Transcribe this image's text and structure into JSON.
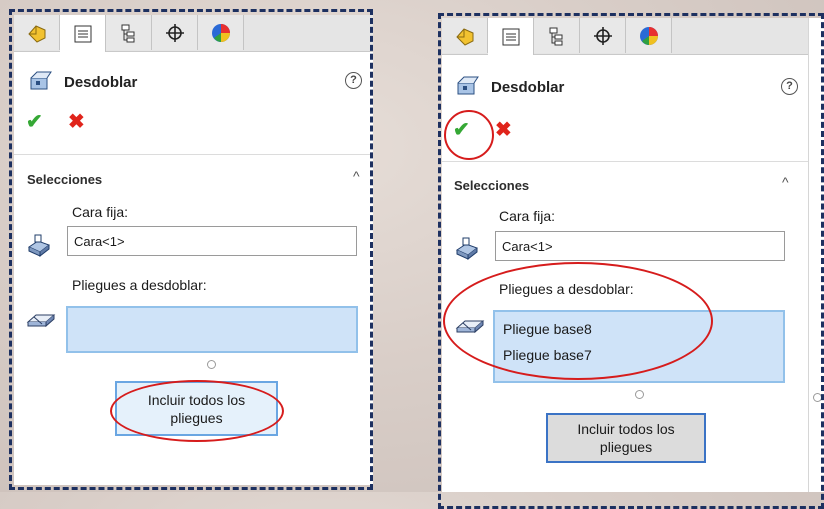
{
  "colors": {
    "accent_blue": "#92c1ea",
    "list_fill": "#cfe3f8",
    "ok_green": "#35a835",
    "cancel_red": "#e0241b",
    "annotation_red": "#d61c1c",
    "dash_border": "#1d3060"
  },
  "tabs": [
    {
      "icon": "feature-manager-icon"
    },
    {
      "icon": "property-manager-icon"
    },
    {
      "icon": "configuration-manager-icon"
    },
    {
      "icon": "dimxpert-icon"
    },
    {
      "icon": "display-manager-icon"
    }
  ],
  "panel_left": {
    "title": "Desdoblar",
    "help": "?",
    "ok": "✔",
    "cancel": "✖",
    "section": "Selecciones",
    "caret": "^",
    "fixed_face_label": "Cara fija:",
    "fixed_face_value": "Cara<1>",
    "bends_label": "Pliegues a desdoblar:",
    "bends": [],
    "include_all_button": "Incluir todos los pliegues"
  },
  "panel_right": {
    "title": "Desdoblar",
    "help": "?",
    "ok": "✔",
    "cancel": "✖",
    "section": "Selecciones",
    "caret": "^",
    "fixed_face_label": "Cara fija:",
    "fixed_face_value": "Cara<1>",
    "bends_label": "Pliegues a desdoblar:",
    "bends": [
      "Pliegue base8",
      "Pliegue base7"
    ],
    "include_all_button": "Incluir todos los pliegues"
  }
}
